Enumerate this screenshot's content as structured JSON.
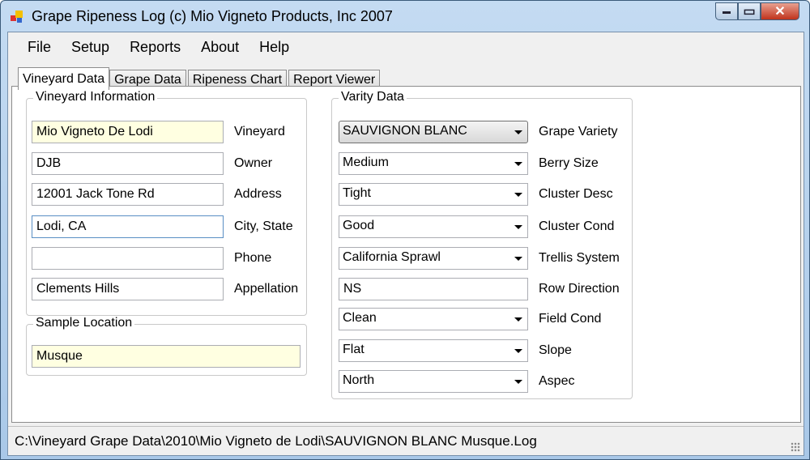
{
  "window": {
    "title": "Grape Ripeness Log (c) Mio Vigneto Products, Inc 2007",
    "close": "✕",
    "min": "▬",
    "max": "▭"
  },
  "menu": [
    "File",
    "Setup",
    "Reports",
    "About",
    "Help"
  ],
  "tabs": [
    "Vineyard Data",
    "Grape Data",
    "Ripeness Chart",
    "Report Viewer"
  ],
  "vineyard_info": {
    "title": "Vineyard Information",
    "fields": [
      {
        "label": "Vineyard",
        "value": "Mio Vigneto De Lodi"
      },
      {
        "label": "Owner",
        "value": "DJB"
      },
      {
        "label": "Address",
        "value": "12001 Jack Tone Rd"
      },
      {
        "label": "City, State",
        "value": "Lodi, CA"
      },
      {
        "label": "Phone",
        "value": ""
      },
      {
        "label": "Appellation",
        "value": "Clements Hills"
      }
    ]
  },
  "sample_location": {
    "title": "Sample Location",
    "value": "Musque"
  },
  "variety_data": {
    "title": "Varity Data",
    "fields": [
      {
        "label": "Grape Variety",
        "value": "SAUVIGNON BLANC"
      },
      {
        "label": "Berry Size",
        "value": "Medium"
      },
      {
        "label": "Cluster Desc",
        "value": "Tight"
      },
      {
        "label": "Cluster Cond",
        "value": "Good"
      },
      {
        "label": "Trellis System",
        "value": "California Sprawl"
      },
      {
        "label": "Row Direction",
        "value": "NS"
      },
      {
        "label": "Field Cond",
        "value": "Clean"
      },
      {
        "label": "Slope",
        "value": "Flat"
      },
      {
        "label": "Aspec",
        "value": "North"
      }
    ]
  },
  "status": "C:\\Vineyard Grape Data\\2010\\Mio Vigneto de Lodi\\SAUVIGNON BLANC Musque.Log"
}
